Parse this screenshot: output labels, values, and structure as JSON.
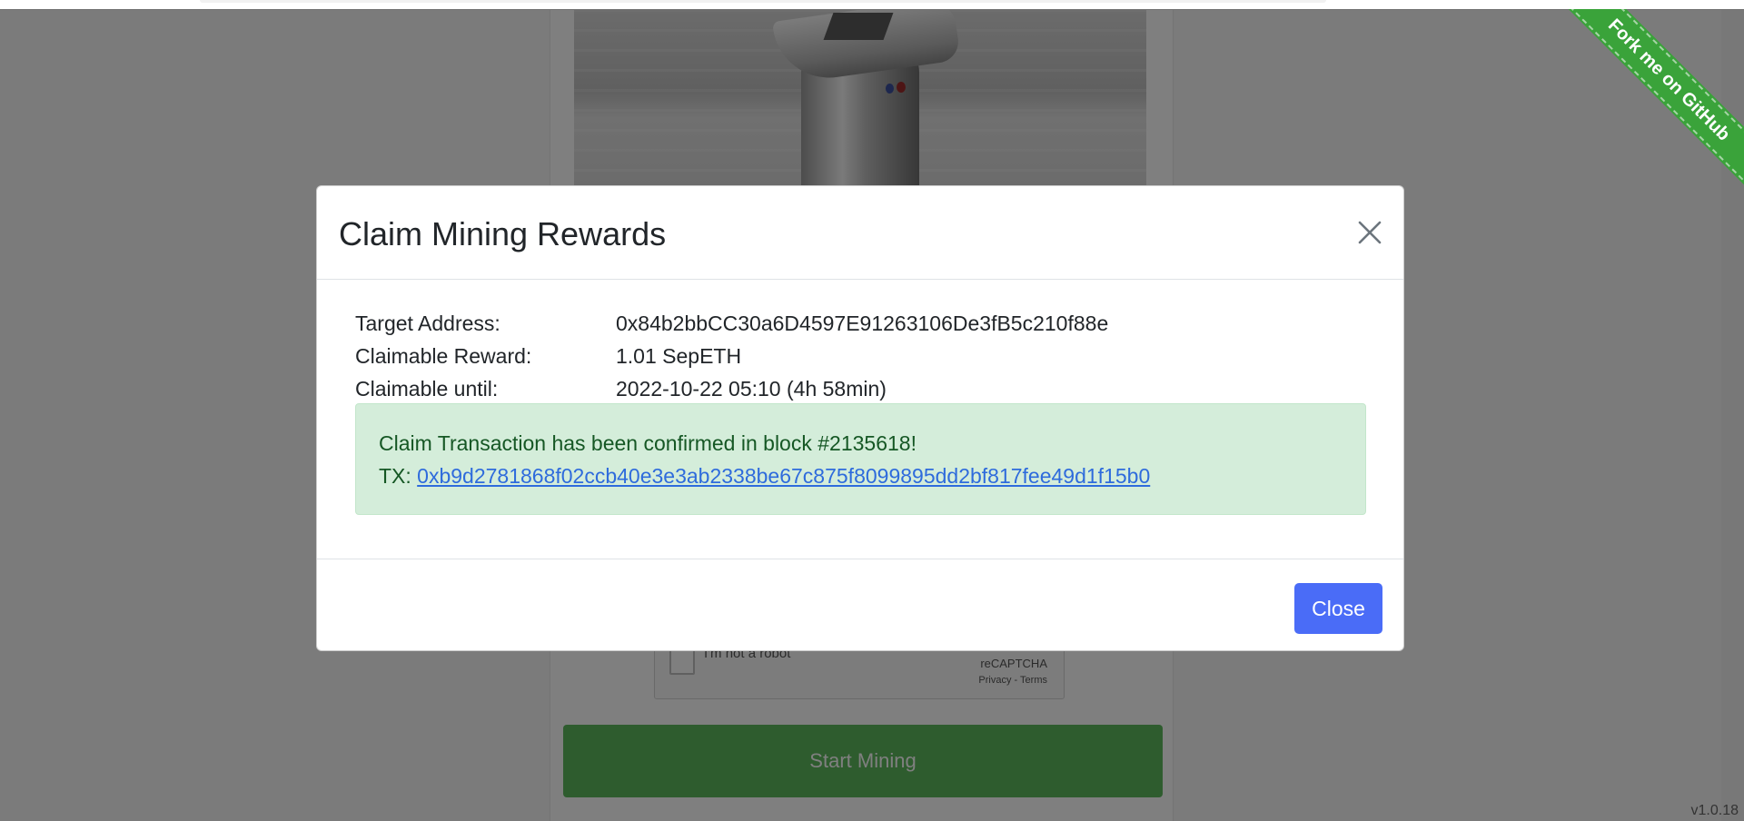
{
  "modal": {
    "title": "Claim Mining Rewards",
    "close_icon": "close-icon",
    "rows": [
      {
        "label": "Target Address:",
        "value": "0x84b2bbCC30a6D4597E91263106De3fB5c210f88e"
      },
      {
        "label": "Claimable Reward:",
        "value": "1.01 SepETH"
      },
      {
        "label": "Claimable until:",
        "value": "2022-10-22 05:10 (4h 58min)"
      }
    ],
    "alert": {
      "message": "Claim Transaction has been confirmed in block #2135618!",
      "tx_label": "TX:",
      "tx_hash": "0xb9d2781868f02ccb40e3e3ab2338be67c875f8099895dd2bf817fee49d1f15b0"
    },
    "close_button": "Close"
  },
  "background": {
    "recaptcha": {
      "label": "I'm not a robot",
      "brand": "reCAPTCHA",
      "links": "Privacy - Terms"
    },
    "start_button": "Start Mining",
    "ribbon": "Fork me on GitHub",
    "version": "v1.0.18"
  },
  "colors": {
    "primary": "#4a6cf7",
    "success_bg": "#d4edda",
    "success_text": "#155724",
    "start_button": "#5cb85c",
    "ribbon": "#3aa33a"
  }
}
